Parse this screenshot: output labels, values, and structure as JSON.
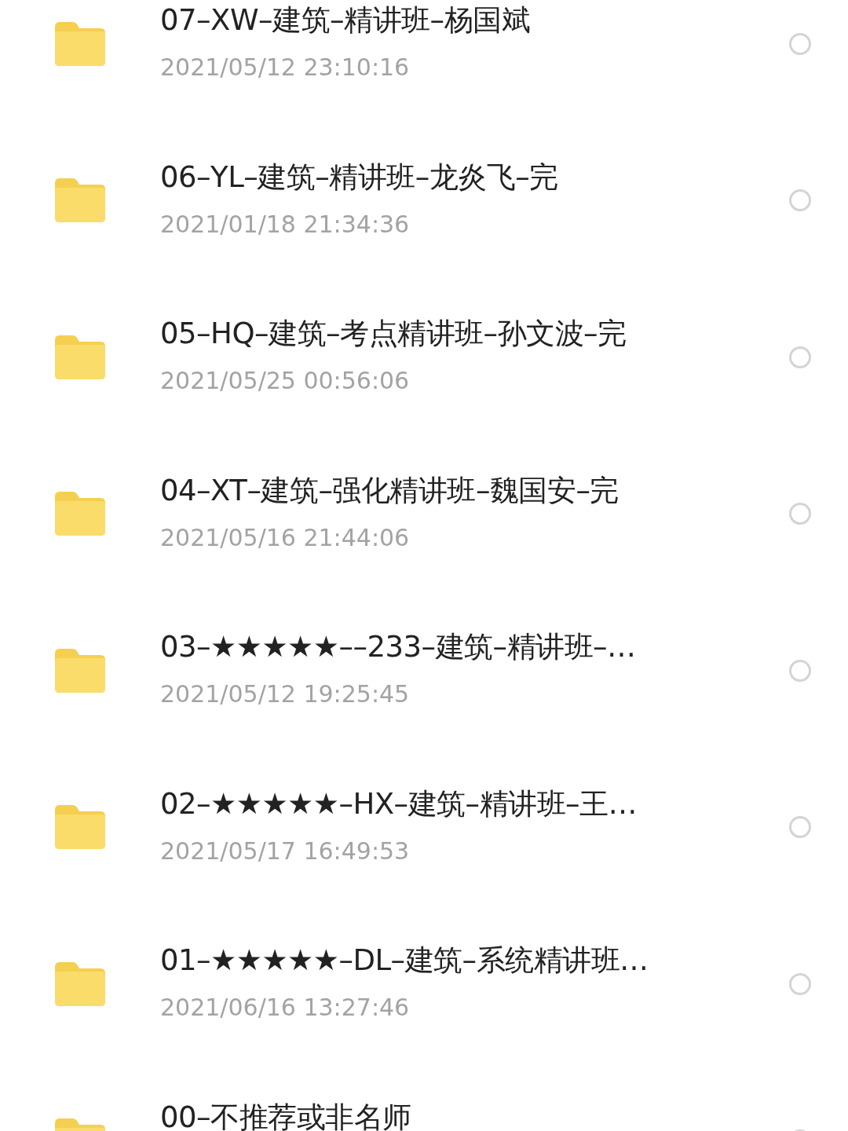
{
  "files": [
    {
      "title": "07–XW–建筑–精讲班–杨国斌",
      "date": "2021/05/12 23:10:16",
      "selected": false
    },
    {
      "title": "06–YL–建筑–精讲班–龙炎飞–完",
      "date": "2021/01/18 21:34:36",
      "selected": false
    },
    {
      "title": "05–HQ–建筑–考点精讲班–孙文波–完",
      "date": "2021/05/25 00:56:06",
      "selected": false
    },
    {
      "title": "04–XT–建筑–强化精讲班–魏国安–完",
      "date": "2021/05/16 21:44:06",
      "selected": false
    },
    {
      "title": "03–★★★★★––233–建筑–精讲班–…",
      "date": "2021/05/12 19:25:45",
      "selected": false
    },
    {
      "title": "02–★★★★★–HX–建筑–精讲班–王…",
      "date": "2021/05/17 16:49:53",
      "selected": false
    },
    {
      "title": "01–★★★★★–DL–建筑–系统精讲班…",
      "date": "2021/06/16 13:27:46",
      "selected": false
    },
    {
      "title": "00–不推荐或非名师",
      "selected": false
    }
  ]
}
